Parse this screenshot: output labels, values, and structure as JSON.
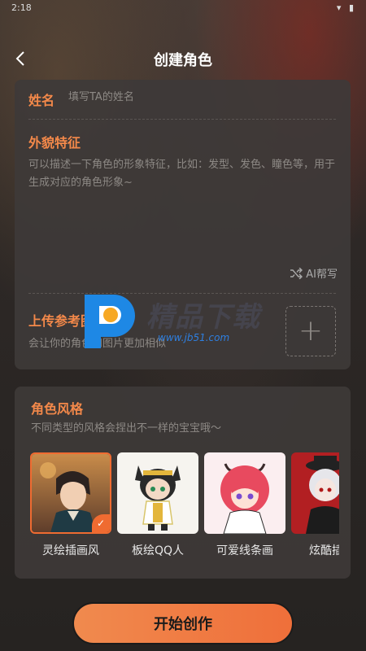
{
  "status": {
    "time": "2:18",
    "icons": "▾ ▮"
  },
  "header": {
    "title": "创建角色"
  },
  "name": {
    "label": "姓名",
    "placeholder": "填写TA的姓名"
  },
  "appearance": {
    "label": "外貌特征",
    "placeholder": "可以描述一下角色的形象特征，比如：发型、发色、瞳色等，用于生成对应的角色形象~",
    "ai_help": "AI帮写"
  },
  "upload": {
    "label": "上传参考图",
    "description": "会让你的角色和图片更加相似"
  },
  "watermark": {
    "text": "精品下载",
    "url": "www.jb51.com"
  },
  "styles": {
    "label": "角色风格",
    "description": "不同类型的风格会捏出不一样的宝宝哦～",
    "items": [
      {
        "name": "灵绘插画风",
        "selected": true
      },
      {
        "name": "板绘QQ人",
        "selected": false
      },
      {
        "name": "可爱线条画",
        "selected": false
      },
      {
        "name": "炫酷插画",
        "selected": false
      }
    ]
  },
  "start_button": {
    "label": "开始创作"
  },
  "colors": {
    "accent": "#ef6b31",
    "card": "#3e3a38",
    "label": "#f4894a"
  }
}
